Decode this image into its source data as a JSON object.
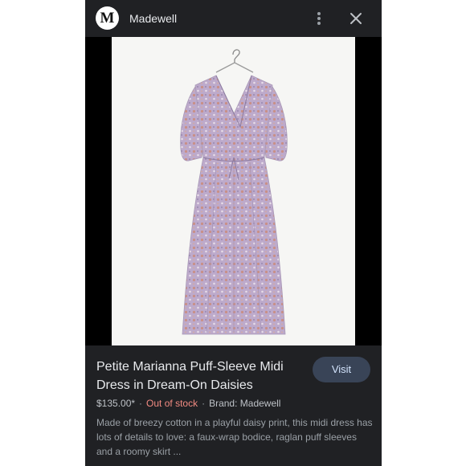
{
  "header": {
    "logo_letter": "M",
    "site_name": "Madewell",
    "more_icon": "more-vertical-icon",
    "close_icon": "close-icon"
  },
  "product": {
    "title": "Petite Marianna Puff-Sleeve Midi Dress in Dream-On Daisies",
    "visit_label": "Visit",
    "price": "$135.00*",
    "stock_status": "Out of stock",
    "brand": "Brand: Madewell",
    "description": "Made of breezy cotton in a playful daisy print, this midi dress has lots of details to love: a faux-wrap bodice, raglan puff sleeves and a roomy skirt ..."
  },
  "colors": {
    "background": "#202124",
    "image_backdrop": "#f6f6f4",
    "visit_button": "#394457",
    "out_of_stock": "#f28b82",
    "dress_base": "#b9a7c6"
  }
}
